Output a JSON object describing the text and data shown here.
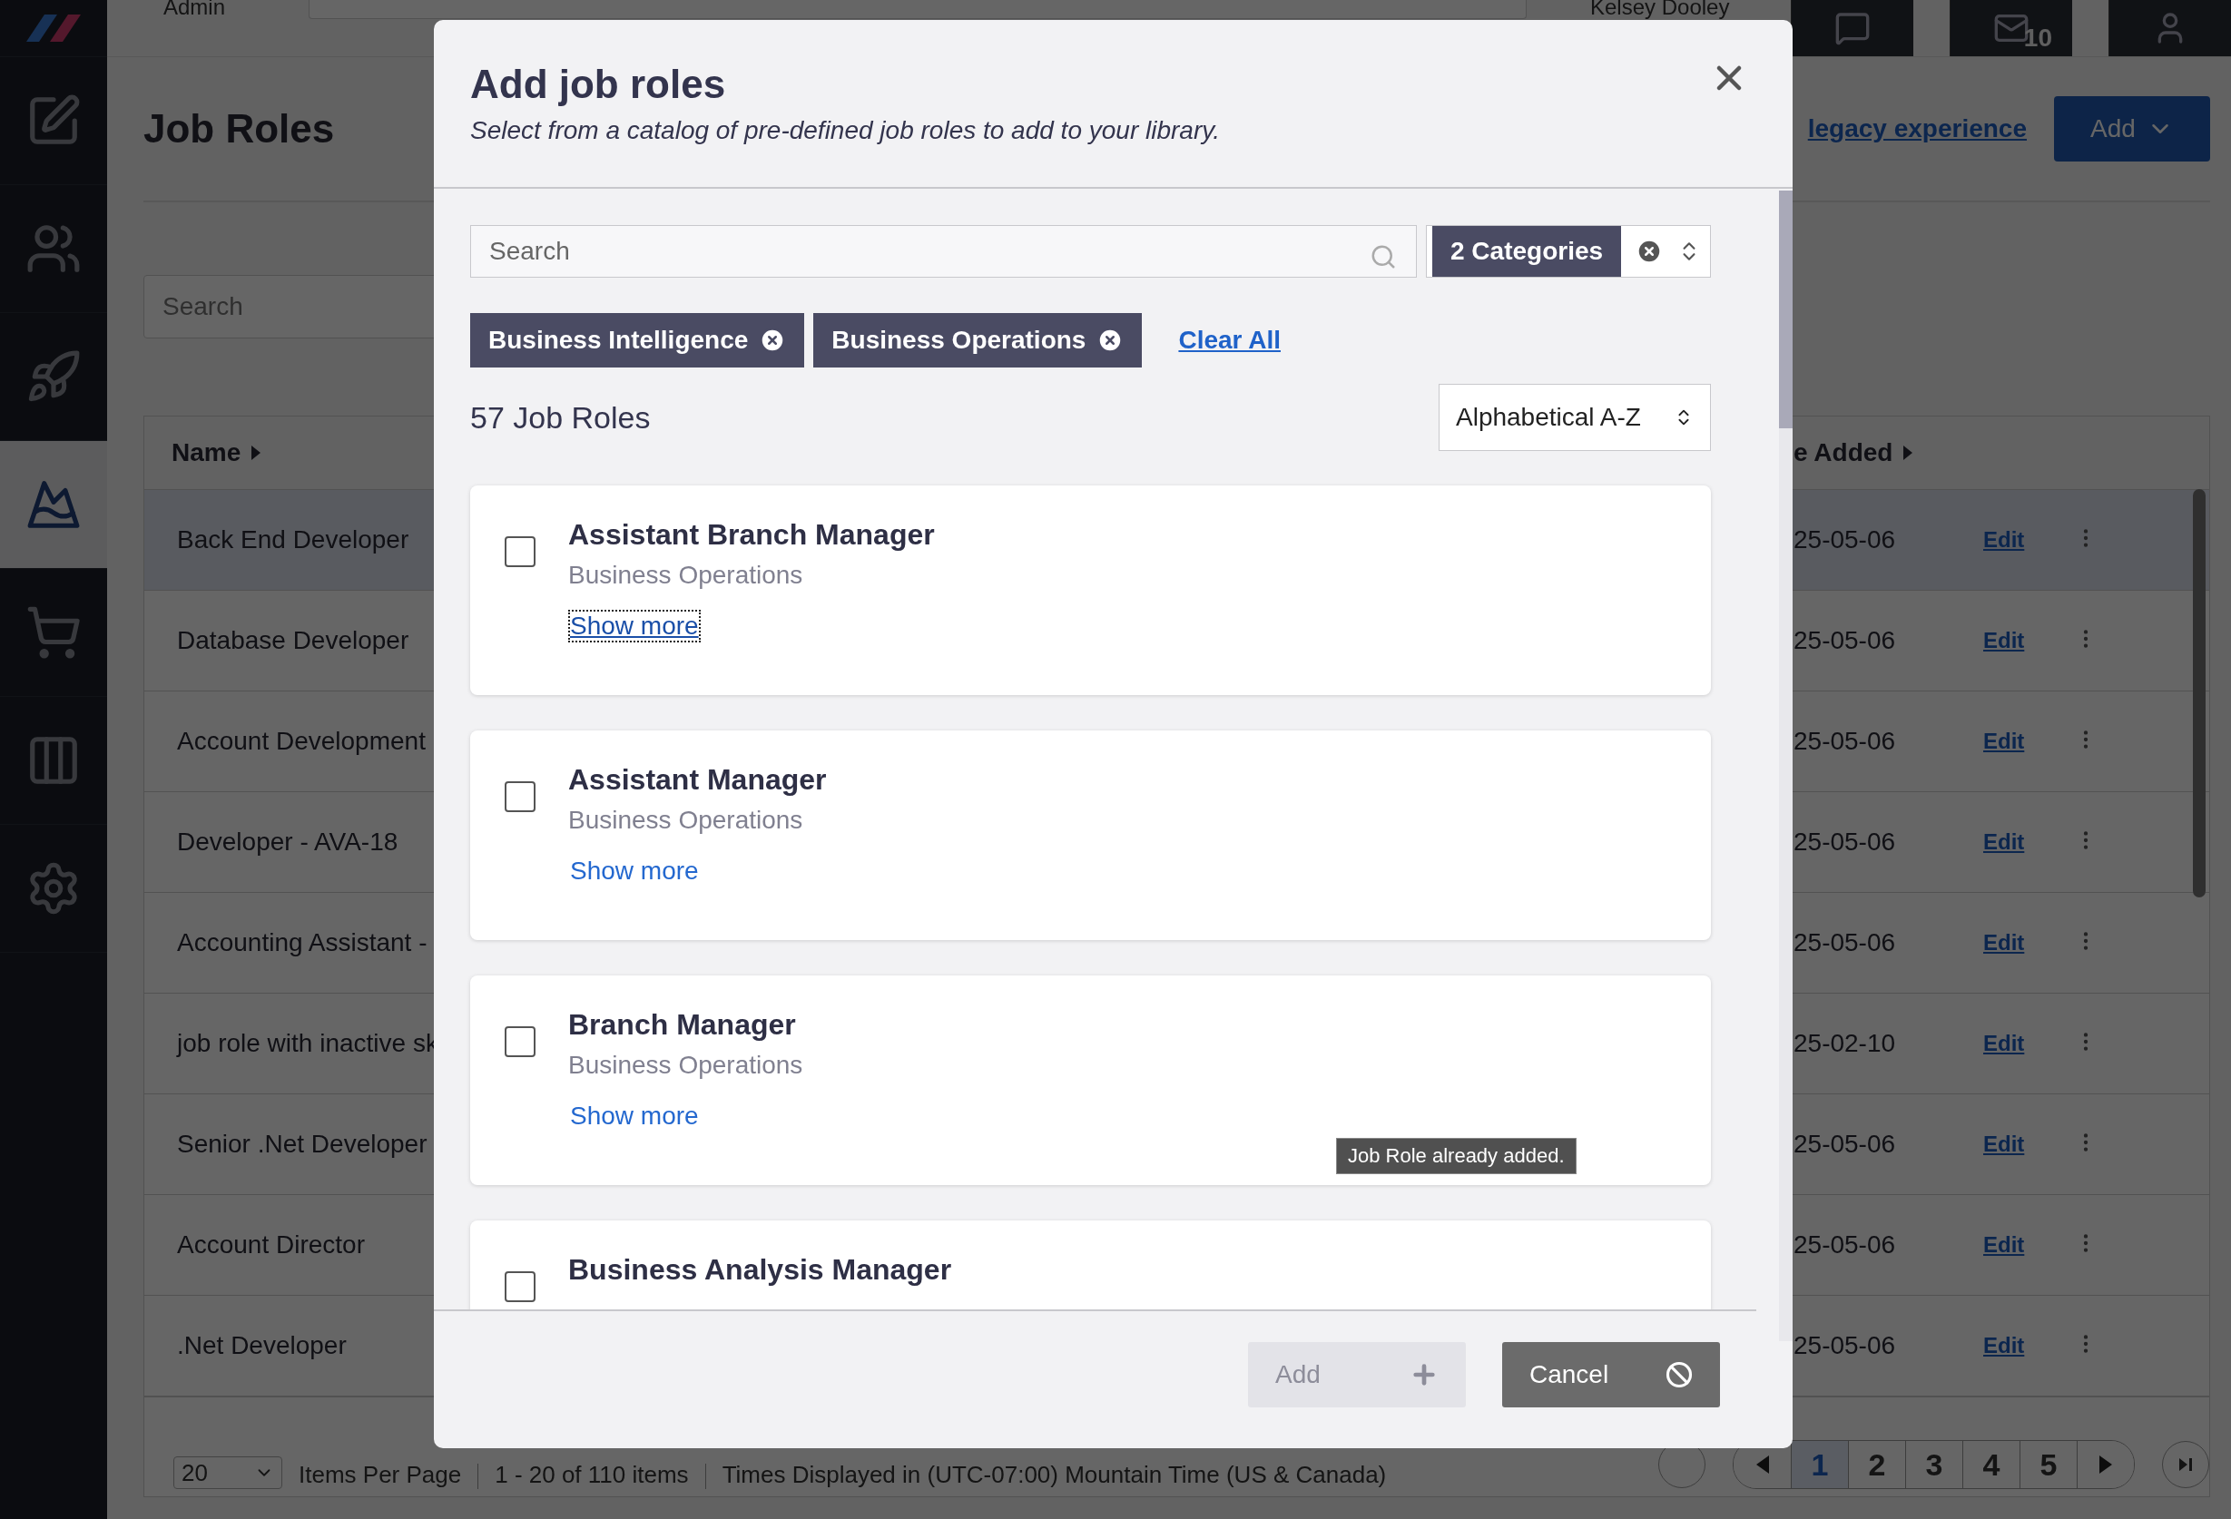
{
  "top_bar": {
    "section_label": "Admin",
    "user_name": "Kelsey Dooley",
    "notifications": [
      {
        "kind": "chat"
      },
      {
        "kind": "mail",
        "count": "10"
      },
      {
        "kind": "user"
      }
    ]
  },
  "sidebar": {
    "items": [
      {
        "kind": "logo",
        "selected": false
      },
      {
        "kind": "edit",
        "selected": false
      },
      {
        "kind": "users",
        "selected": false
      },
      {
        "kind": "rocket",
        "selected": false
      },
      {
        "kind": "mountain",
        "selected": true
      },
      {
        "kind": "cart",
        "selected": false
      },
      {
        "kind": "columns",
        "selected": false
      },
      {
        "kind": "settings",
        "selected": false
      }
    ]
  },
  "page": {
    "title": "Job Roles",
    "legacy_link": "legacy experience",
    "add_button": "Add",
    "search": {
      "placeholder": "Search"
    }
  },
  "table": {
    "columns": [
      "Name",
      "e Added"
    ],
    "rows": [
      {
        "name": "Back End Developer",
        "date": "25-05-06",
        "action": "Edit",
        "selected": true
      },
      {
        "name": "Database Developer",
        "date": "25-05-06",
        "action": "Edit",
        "selected": false
      },
      {
        "name": "Account Development",
        "date": "25-05-06",
        "action": "Edit",
        "selected": false
      },
      {
        "name": "Developer - AVA-18",
        "date": "25-05-06",
        "action": "Edit",
        "selected": false
      },
      {
        "name": "Accounting Assistant -",
        "date": "25-05-06",
        "action": "Edit",
        "selected": false
      },
      {
        "name": "job role with inactive sk",
        "date": "25-02-10",
        "action": "Edit",
        "selected": false
      },
      {
        "name": "Senior .Net Developer",
        "date": "25-05-06",
        "action": "Edit",
        "selected": false
      },
      {
        "name": "Account Director",
        "date": "25-05-06",
        "action": "Edit",
        "selected": false
      },
      {
        "name": ".Net Developer",
        "date": "25-05-06",
        "action": "Edit",
        "selected": false
      }
    ]
  },
  "footer": {
    "page_size": "20",
    "items_per_page_label": "Items Per Page",
    "range": "1 - 20 of 110 items",
    "timezone": "Times Displayed in (UTC-07:00) Mountain Time (US & Canada)",
    "pages": [
      {
        "label": "1",
        "selected": true
      },
      {
        "label": "2",
        "selected": false
      },
      {
        "label": "3",
        "selected": false
      },
      {
        "label": "4",
        "selected": false
      },
      {
        "label": "5",
        "selected": false
      }
    ]
  },
  "modal": {
    "title": "Add job roles",
    "subtitle": "Select from a catalog of pre-defined job roles to add to your library.",
    "search": {
      "placeholder": "Search"
    },
    "category_filter": "2 Categories",
    "chips": [
      "Business Intelligence",
      "Business Operations"
    ],
    "clear_all": "Clear All",
    "count": "57 Job Roles",
    "sort": "Alphabetical A-Z",
    "cards": [
      {
        "title": "Assistant Branch Manager",
        "category": "Business Operations",
        "show_more": "Show more",
        "checked": false,
        "focused": true
      },
      {
        "title": "Assistant Manager",
        "category": "Business Operations",
        "show_more": "Show more",
        "checked": false,
        "focused": false
      },
      {
        "title": "Branch Manager",
        "category": "Business Operations",
        "show_more": "Show more",
        "checked": false,
        "focused": false
      },
      {
        "title": "Business Analysis Manager",
        "checked": false
      }
    ],
    "tooltip": "Job Role already added.",
    "add_button": {
      "label": "Add",
      "disabled": true
    },
    "cancel_button": "Cancel"
  }
}
